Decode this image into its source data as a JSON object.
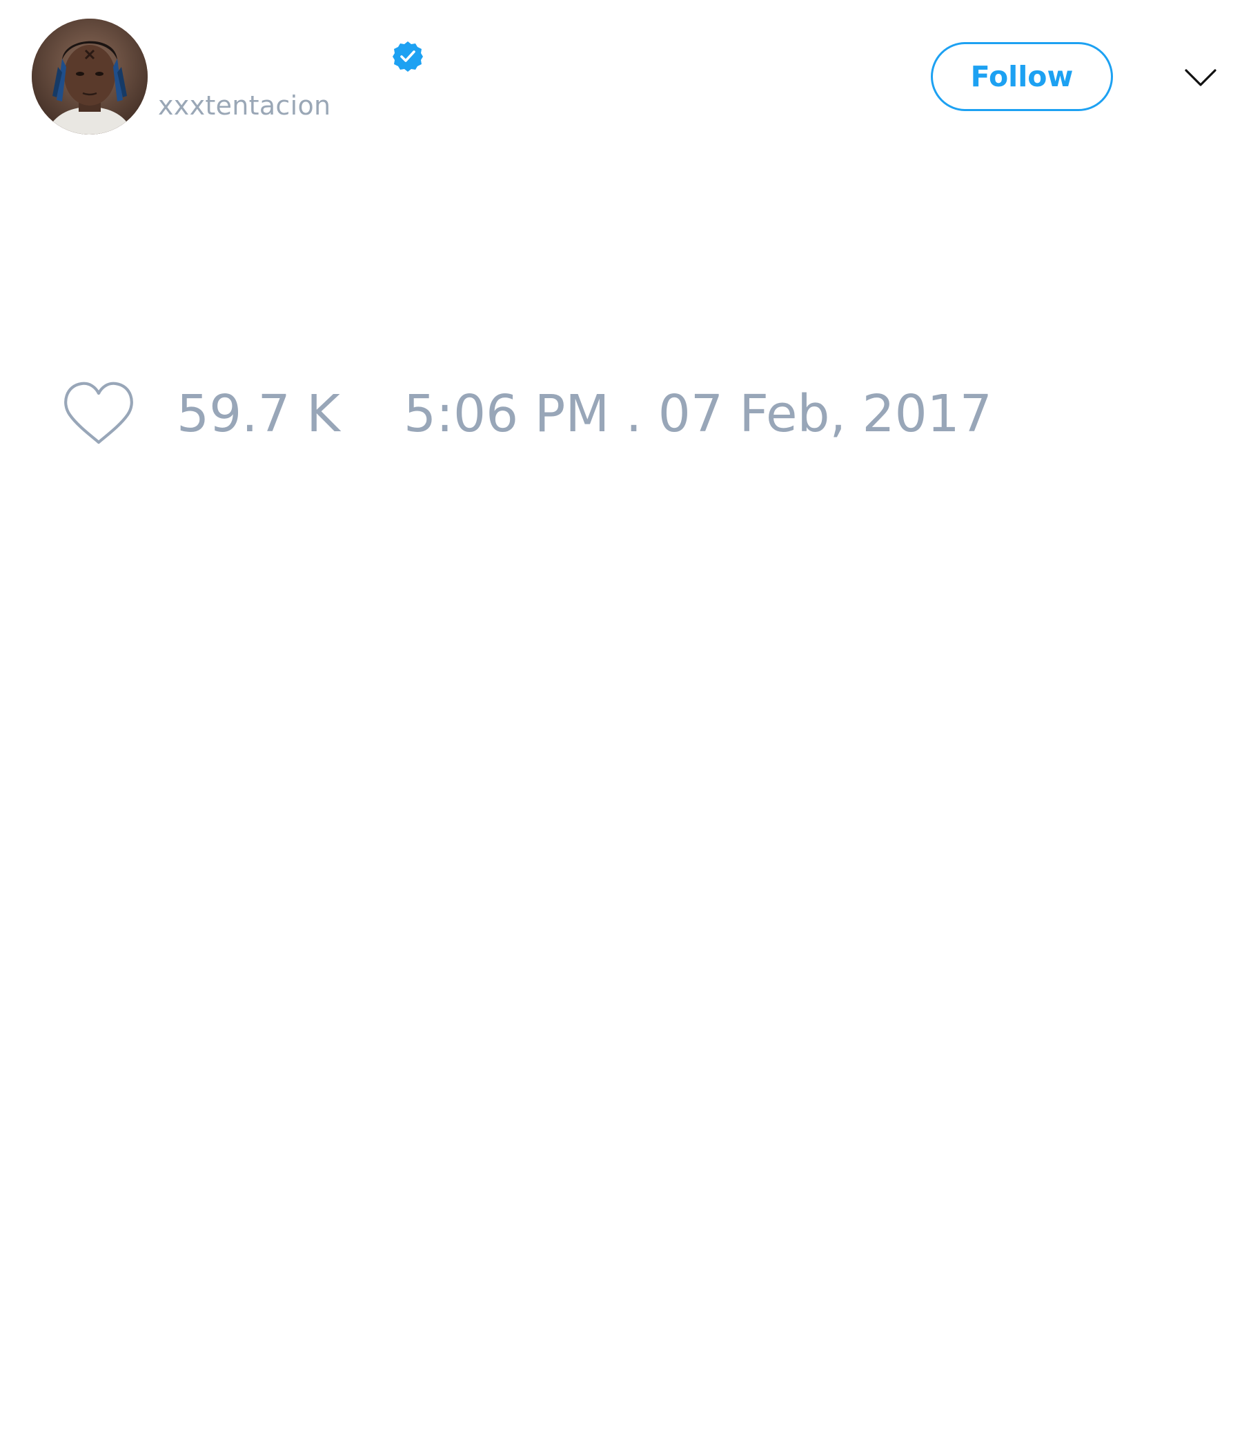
{
  "header": {
    "display_name": "",
    "username": "xxxtentacion",
    "verified": true,
    "avatar_icon": "profile-photo",
    "follow_label": "Follow",
    "menu_icon": "chevron-down-icon"
  },
  "footer": {
    "like_icon": "heart-outline-icon",
    "like_count": "59.7 K",
    "timestamp": "5:06 PM . 07 Feb, 2017"
  },
  "colors": {
    "brand_blue": "#1da1f2",
    "muted_text": "#98a6b8",
    "background": "#ffffff"
  }
}
